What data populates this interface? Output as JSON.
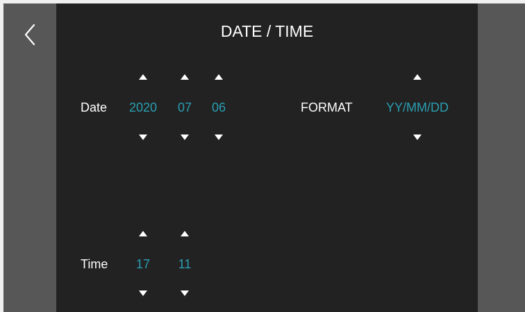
{
  "header": {
    "title": "DATE / TIME",
    "back_icon": "chevron-left-icon"
  },
  "date": {
    "label": "Date",
    "year": "2020",
    "month": "07",
    "day": "06"
  },
  "format": {
    "label": "FORMAT",
    "value": "YY/MM/DD"
  },
  "time": {
    "label": "Time",
    "hour": "17",
    "minute": "11"
  },
  "colors": {
    "accent": "#2a9fb3",
    "background": "#222222",
    "side_panel": "#575757",
    "text": "#ffffff"
  },
  "icons": {
    "increment": "caret-up-icon",
    "decrement": "caret-down-icon"
  }
}
